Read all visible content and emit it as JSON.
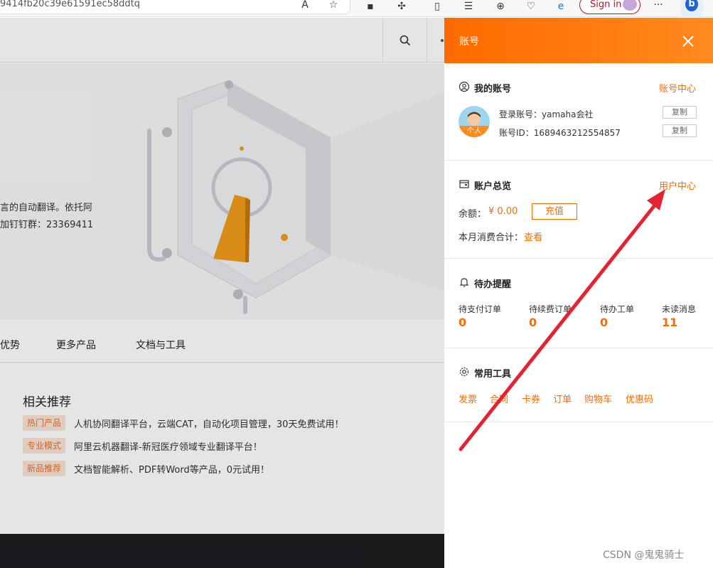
{
  "browser": {
    "url": "9414fb20c39e61591ec58ddtq",
    "signin_label": "Sign in"
  },
  "page": {
    "hero_text_1": "言的自动翻译。依托阿",
    "hero_text_2": "加钉钉群：23369411",
    "tabs": [
      "优势",
      "更多产品",
      "文档与工具"
    ],
    "recommend_title": "相关推荐",
    "recommend_items": [
      {
        "tag": "热门产品",
        "text": "人机协同翻译平台，云端CAT，自动化项目管理，30天免费试用！"
      },
      {
        "tag": "专业模式",
        "text": "阿里云机器翻译-新冠医疗领域专业翻译平台！"
      },
      {
        "tag": "新品推荐",
        "text": "文档智能解析、PDF转Word等产品，0元试用！"
      }
    ]
  },
  "panel": {
    "title": "账号",
    "my_account": {
      "title": "我的账号",
      "link": "账号中心",
      "avatar_label": "个人",
      "login_account": "登录账号：yamaha会社",
      "account_id": "账号ID：1689463212554857",
      "copy_label": "复制"
    },
    "overview": {
      "title": "账户总览",
      "link": "用户中心",
      "balance_label": "余额：",
      "balance_value": "¥ 0.00",
      "recharge_label": "充值",
      "monthly_label": "本月消费合计：",
      "monthly_link": "查看"
    },
    "todo": {
      "title": "待办提醒",
      "items": [
        {
          "label": "待支付订单",
          "value": "0"
        },
        {
          "label": "待续费订单",
          "value": "0"
        },
        {
          "label": "待办工单",
          "value": "0"
        },
        {
          "label": "未读消息",
          "value": "11"
        }
      ]
    },
    "tools": {
      "title": "常用工具",
      "items": [
        "发票",
        "合同",
        "卡券",
        "订单",
        "购物车",
        "优惠码"
      ]
    }
  },
  "watermark": "CSDN @鬼鬼骑士",
  "colors": {
    "accent": "#ff6a00",
    "arrow": "#e52330",
    "footer": "#1b1c1f"
  }
}
